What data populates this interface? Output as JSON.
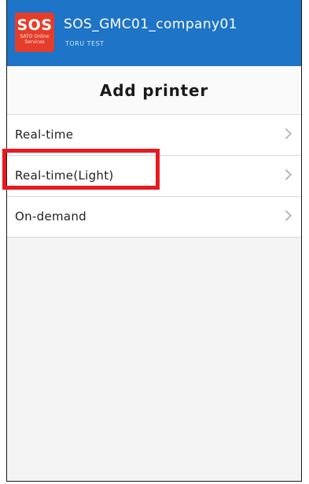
{
  "appbar": {
    "logo_text": "SOS",
    "logo_subtext": "SATO Online Services",
    "title": "SOS_GMC01_company01",
    "subtitle": "TORU TEST",
    "background_color": "#1e74c6",
    "logo_color": "#e63d2a"
  },
  "page": {
    "title": "Add printer"
  },
  "printer_types": [
    {
      "label": "Real-time",
      "icon": "chevron-right-icon"
    },
    {
      "label": "Real-time(Light)",
      "icon": "chevron-right-icon",
      "highlighted": true
    },
    {
      "label": "On-demand",
      "icon": "chevron-right-icon"
    }
  ],
  "highlight": {
    "color": "#e8191f",
    "target": "Real-time(Light)"
  }
}
